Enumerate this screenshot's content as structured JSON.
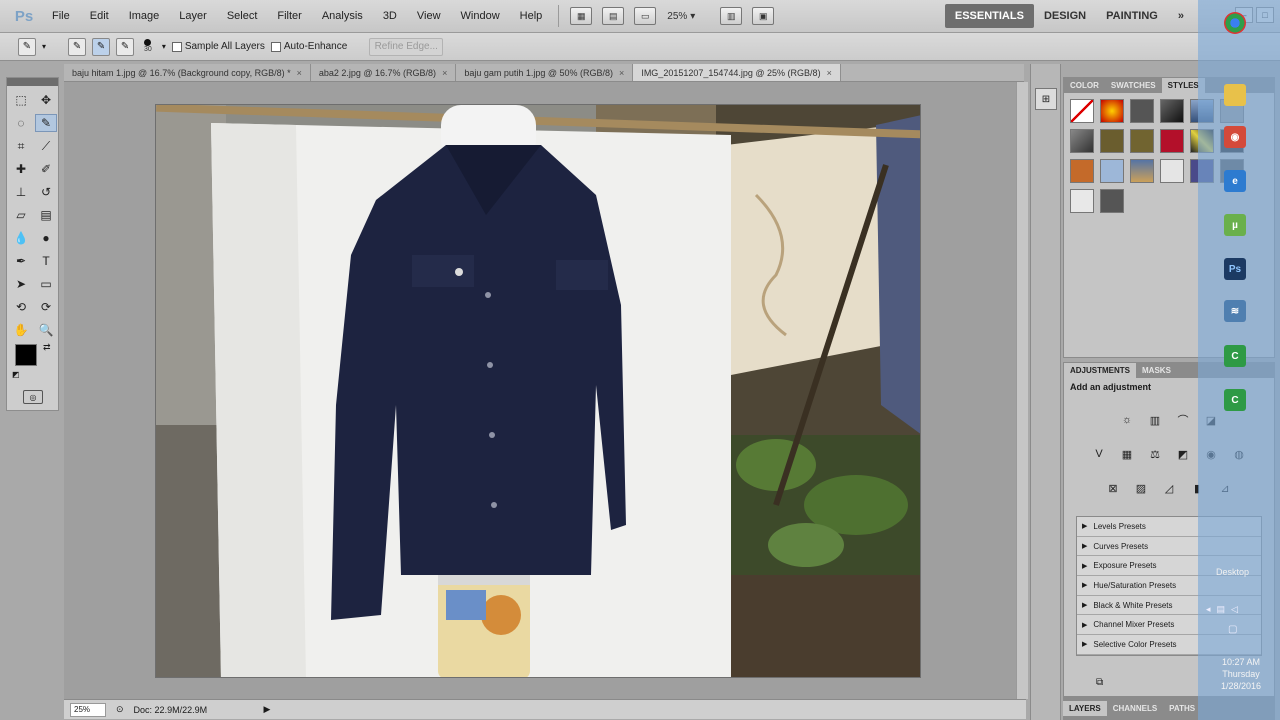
{
  "app": {
    "logo": "Ps"
  },
  "menu": [
    "File",
    "Edit",
    "Image",
    "Layer",
    "Select",
    "Filter",
    "Analysis",
    "3D",
    "View",
    "Window",
    "Help"
  ],
  "menubar_zoom": "25%",
  "workspaces": {
    "essentials": "ESSENTIALS",
    "design": "DESIGN",
    "painting": "PAINTING",
    "more": "»"
  },
  "options": {
    "brush_size": "30",
    "sample_all_layers": "Sample All Layers",
    "auto_enhance": "Auto-Enhance",
    "refine_edge": "Refine Edge..."
  },
  "tabs": [
    {
      "label": "baju hitam 1.jpg @ 16.7% (Background copy, RGB/8) *",
      "active": false
    },
    {
      "label": "aba2 2.jpg @ 16.7% (RGB/8)",
      "active": false
    },
    {
      "label": "baju gam putih 1.jpg @ 50% (RGB/8)",
      "active": false
    },
    {
      "label": "IMG_20151207_154744.jpg @ 25% (RGB/8)",
      "active": true
    }
  ],
  "status": {
    "zoom": "25%",
    "doc": "Doc: 22.9M/22.9M"
  },
  "styles_panel": {
    "tabs": [
      "COLOR",
      "SWATCHES",
      "STYLES"
    ],
    "active": "STYLES"
  },
  "adjustments_panel": {
    "tabs": [
      "ADJUSTMENTS",
      "MASKS"
    ],
    "title": "Add an adjustment",
    "presets": [
      "Levels Presets",
      "Curves Presets",
      "Exposure Presets",
      "Hue/Saturation Presets",
      "Black & White Presets",
      "Channel Mixer Presets",
      "Selective Color Presets"
    ]
  },
  "layers_tabs": [
    "LAYERS",
    "CHANNELS",
    "PATHS"
  ],
  "taskbar": {
    "desktop": "Desktop",
    "time": "10:27 AM",
    "day": "Thursday",
    "date": "1/28/2016"
  }
}
